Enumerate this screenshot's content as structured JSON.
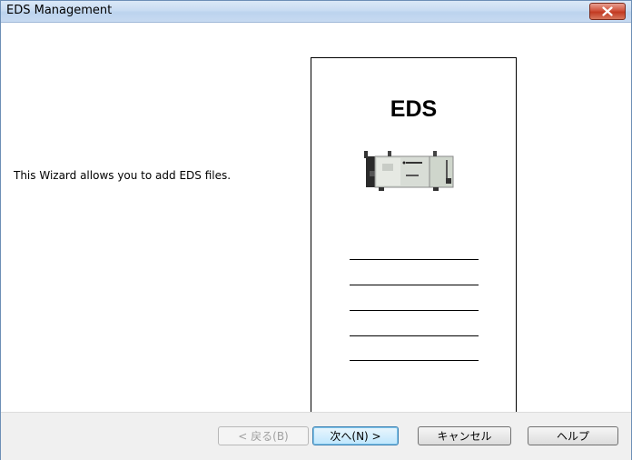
{
  "window": {
    "title": "EDS Management"
  },
  "content": {
    "description": "This Wizard allows you to add EDS files.",
    "panel_title": "EDS"
  },
  "buttons": {
    "back": "< 戻る(B)",
    "next": "次へ(N) >",
    "cancel": "キャンセル",
    "help": "ヘルプ"
  },
  "icons": {
    "close": "close-icon",
    "device": "eds-device-icon"
  },
  "colors": {
    "titlebar": "#c9dcf2",
    "close": "#c7432a",
    "footer": "#f0f0f0"
  }
}
